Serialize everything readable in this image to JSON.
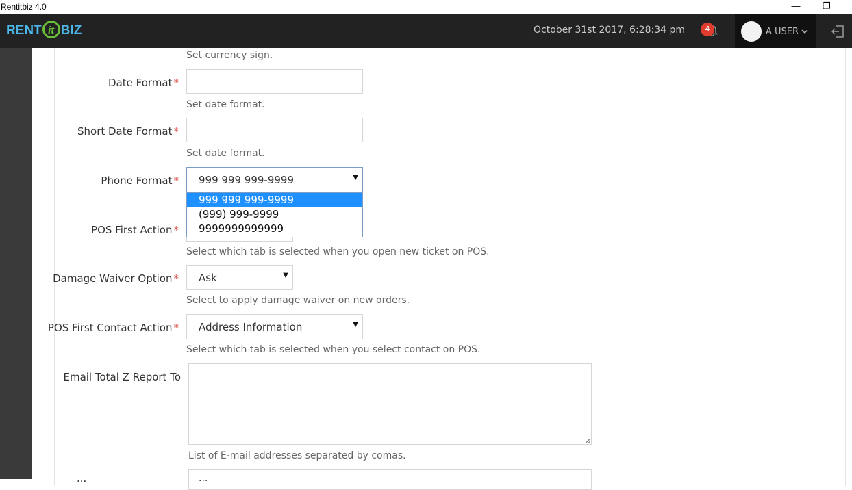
{
  "window": {
    "title": "Rentitbiz 4.0",
    "minimize_glyph": "—",
    "restore_glyph": "❐"
  },
  "header": {
    "logo_left": "RENT",
    "logo_mid": "it",
    "logo_right": "BIZ",
    "datetime": "October 31st 2017, 6:28:34 pm",
    "notification_count": "4",
    "user_name": "A USER",
    "icons": {
      "bell": "bell-icon",
      "caret": "chevron-down-icon",
      "logout": "logout-icon"
    }
  },
  "form": {
    "currency_help": "Set currency sign.",
    "date_format": {
      "label": "Date Format",
      "value": "",
      "help": "Set date format."
    },
    "short_date_format": {
      "label": "Short Date Format",
      "value": "",
      "help": "Set date format."
    },
    "phone_format": {
      "label": "Phone Format",
      "selected": "999 999 999-9999",
      "options": [
        "999 999 999-9999",
        "(999) 999-9999",
        "9999999999999"
      ]
    },
    "pos_first_action": {
      "label": "POS First Action",
      "help": "Select which tab is selected when you open new ticket on POS."
    },
    "damage_waiver": {
      "label": "Damage Waiver Option",
      "selected": "Ask",
      "help": "Select to apply damage waiver on new orders."
    },
    "pos_first_contact_action": {
      "label": "POS First Contact Action",
      "selected": "Address Information",
      "help": "Select which tab is selected when you select contact on POS."
    },
    "email_total_z": {
      "label": "Email Total Z Report To",
      "value": "",
      "help": "List of E-mail addresses separated by comas."
    },
    "required_mark": "*",
    "partial_next_label": "...",
    "partial_next_value": "..."
  },
  "colors": {
    "topbar": "#222222",
    "sidebar": "#3a3a3a",
    "required": "#d9534f",
    "selected_option": "#1e90ff",
    "badge": "#e03d2e"
  }
}
